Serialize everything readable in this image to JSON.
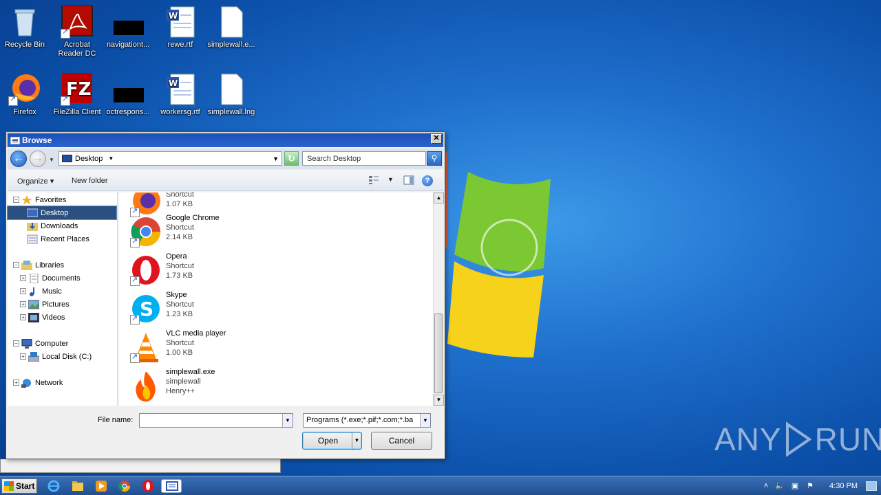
{
  "desktop": {
    "icons": [
      {
        "label": "Recycle Bin"
      },
      {
        "label": "Acrobat Reader DC"
      },
      {
        "label": "navigationt..."
      },
      {
        "label": "rewe.rtf"
      },
      {
        "label": "simplewall.e..."
      },
      {
        "label": "Firefox"
      },
      {
        "label": "FileZilla Client"
      },
      {
        "label": "octrespons..."
      },
      {
        "label": "workersg.rtf"
      },
      {
        "label": "simplewall.lng"
      }
    ]
  },
  "watermark": {
    "left": "ANY",
    "right": "RUN"
  },
  "dialog": {
    "title": "Browse",
    "close_label": "✕",
    "address": {
      "location": "Desktop",
      "search_placeholder": "Search Desktop"
    },
    "toolbar": {
      "organize": "Organize",
      "new_folder": "New folder",
      "help": "?"
    },
    "nav": {
      "favorites": "Favorites",
      "desktop": "Desktop",
      "downloads": "Downloads",
      "recent": "Recent Places",
      "libraries": "Libraries",
      "documents": "Documents",
      "music": "Music",
      "pictures": "Pictures",
      "videos": "Videos",
      "computer": "Computer",
      "local_disk": "Local Disk (C:)",
      "network": "Network"
    },
    "files": [
      {
        "name": "",
        "type": "Shortcut",
        "size": "1.07 KB"
      },
      {
        "name": "Google Chrome",
        "type": "Shortcut",
        "size": "2.14 KB"
      },
      {
        "name": "Opera",
        "type": "Shortcut",
        "size": "1.73 KB"
      },
      {
        "name": "Skype",
        "type": "Shortcut",
        "size": "1.23 KB"
      },
      {
        "name": "VLC media player",
        "type": "Shortcut",
        "size": "1.00 KB"
      },
      {
        "name": "simplewall.exe",
        "type": "simplewall",
        "size": "Henry++"
      }
    ],
    "file_name_label": "File name:",
    "file_name_value": "",
    "file_type": "Programs (*.exe;*.pif;*.com;*.ba",
    "open_label": "Open",
    "cancel_label": "Cancel"
  },
  "taskbar": {
    "start": "Start",
    "clock": "4:30 PM"
  }
}
